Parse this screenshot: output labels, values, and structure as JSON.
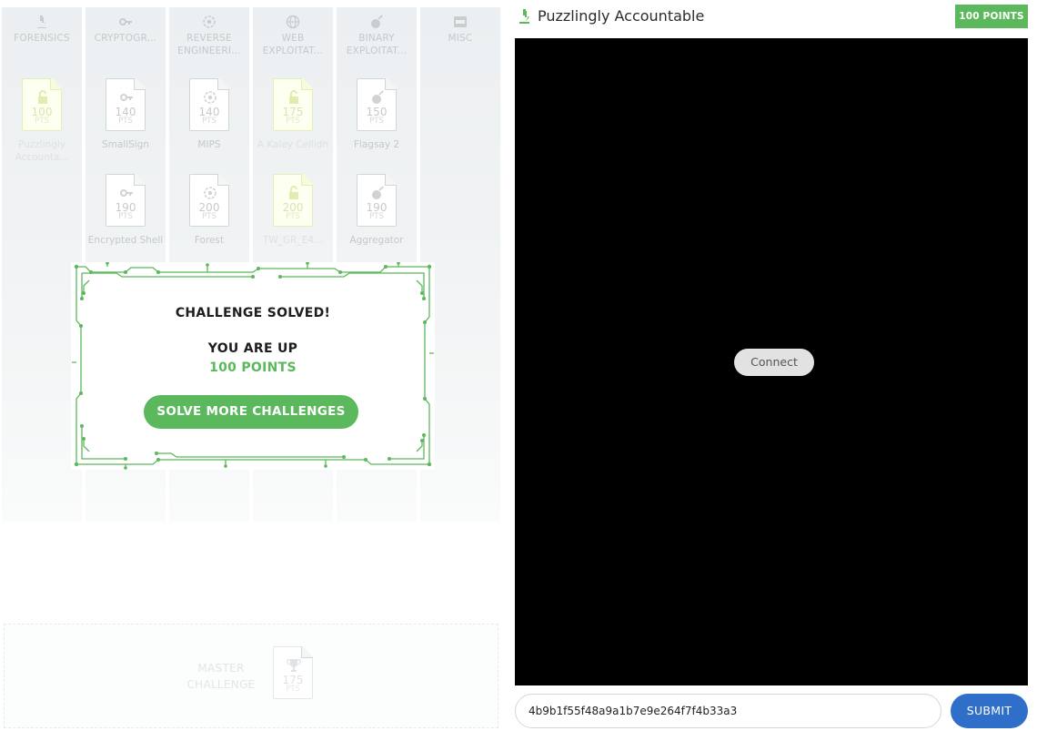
{
  "challenge": {
    "title": "Puzzlingly Accountable",
    "points_badge": "100 POINTS",
    "icon": "forensics-microscope-icon"
  },
  "terminal": {
    "connect_label": "Connect"
  },
  "flag": {
    "value": "4b9b1f55f48a9a1b7e9e264f7f4b33a3",
    "submit_label": "SUBMIT"
  },
  "modal": {
    "title": "CHALLENGE SOLVED!",
    "up_text": "YOU ARE UP",
    "points_text": "100 POINTS",
    "button_label": "SOLVE MORE CHALLENGES"
  },
  "board": {
    "pts_label": "PTS",
    "categories": [
      {
        "name": "FORENSICS",
        "icon": "microscope-icon",
        "cards": [
          {
            "points": "100",
            "name": "Puzzlingly Accounta...",
            "solved": true
          }
        ]
      },
      {
        "name": "CRYPTOGR...",
        "icon": "key-icon",
        "cards": [
          {
            "points": "140",
            "name": "SmallSign",
            "solved": false
          },
          {
            "points": "190",
            "name": "Encrypted Shell",
            "solved": false
          }
        ]
      },
      {
        "name": "REVERSE ENGINEERI...",
        "icon": "eye-gear-icon",
        "cards": [
          {
            "points": "140",
            "name": "MIPS",
            "solved": false
          },
          {
            "points": "200",
            "name": "Forest",
            "solved": false
          }
        ]
      },
      {
        "name": "WEB EXPLOITAT...",
        "icon": "globe-icon",
        "cards": [
          {
            "points": "175",
            "name": "A Kaley Ceilidh",
            "solved": true
          },
          {
            "points": "200",
            "name": "TW_GR_E4...",
            "solved": true
          }
        ]
      },
      {
        "name": "BINARY EXPLOITAT...",
        "icon": "bomb-icon",
        "cards": [
          {
            "points": "150",
            "name": "Flagsay 2",
            "solved": false
          },
          {
            "points": "190",
            "name": "Aggregator",
            "solved": false
          }
        ]
      },
      {
        "name": "MISC",
        "icon": "misc-icon",
        "cards": []
      }
    ],
    "master": {
      "label": "MASTER CHALLENGE",
      "points": "175",
      "icon": "trophy-icon"
    }
  }
}
